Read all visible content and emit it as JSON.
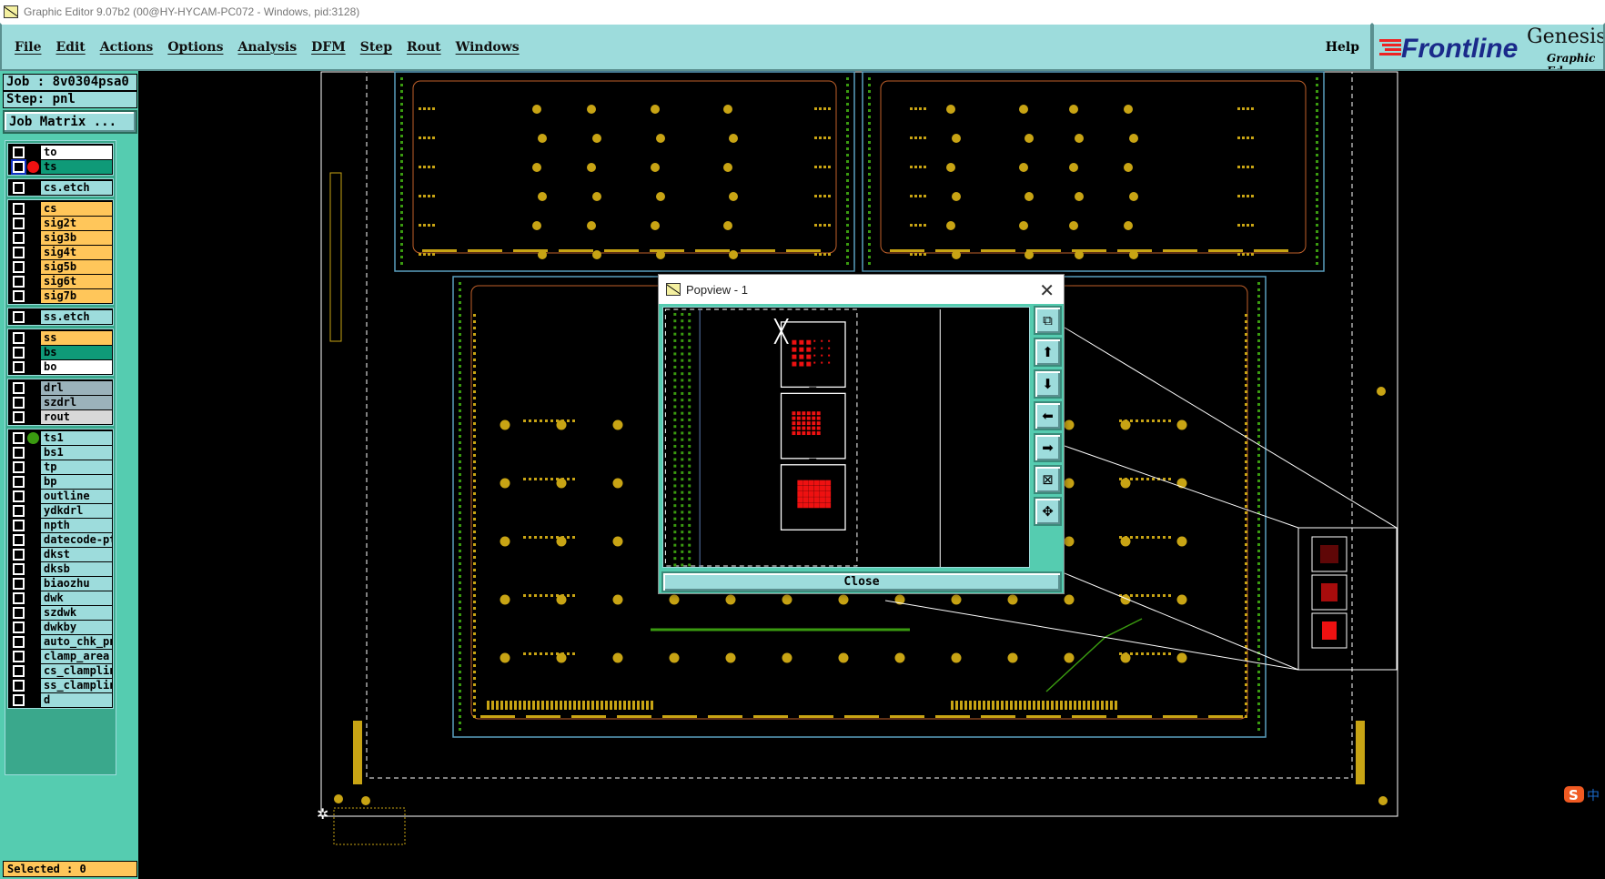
{
  "window": {
    "title": "Graphic Editor 9.07b2 (00@HY-HYCAM-PC072 - Windows, pid:3128)"
  },
  "menu": {
    "items": [
      "File",
      "Edit",
      "Actions",
      "Options",
      "Analysis",
      "DFM",
      "Step",
      "Rout",
      "Windows"
    ],
    "help": "Help"
  },
  "logo": {
    "brand": "Frontline",
    "product": "Genesis",
    "subtitle": "Graphic Ed"
  },
  "job": {
    "job": "Job : 8v0304psa0",
    "step": "Step: pnl",
    "matrix_button": "Job Matrix ..."
  },
  "layers": {
    "groups": [
      [
        {
          "name": "to",
          "color": "#ffffff"
        },
        {
          "name": "ts",
          "color": "#0f9a78",
          "dot": "#ee1111",
          "selected": true
        }
      ],
      [
        {
          "name": "cs.etch",
          "color": "#9ddcdc"
        }
      ],
      [
        {
          "name": "cs",
          "color": "#ffc65a"
        },
        {
          "name": "sig2t",
          "color": "#ffc65a"
        },
        {
          "name": "sig3b",
          "color": "#ffc65a"
        },
        {
          "name": "sig4t",
          "color": "#ffc65a"
        },
        {
          "name": "sig5b",
          "color": "#ffc65a"
        },
        {
          "name": "sig6t",
          "color": "#ffc65a"
        },
        {
          "name": "sig7b",
          "color": "#ffc65a"
        }
      ],
      [
        {
          "name": "ss.etch",
          "color": "#9ddcdc"
        }
      ],
      [
        {
          "name": "ss",
          "color": "#ffc65a"
        },
        {
          "name": "bs",
          "color": "#0f9a78"
        },
        {
          "name": "bo",
          "color": "#ffffff"
        }
      ],
      [
        {
          "name": "drl",
          "color": "#9bb2bb"
        },
        {
          "name": "szdrl",
          "color": "#9bb2bb"
        },
        {
          "name": "rout",
          "color": "#d8d8d8"
        }
      ],
      [
        {
          "name": "ts1",
          "color": "#9ddcdc",
          "dot": "#3a9a10"
        },
        {
          "name": "bs1",
          "color": "#9ddcdc"
        },
        {
          "name": "tp",
          "color": "#9ddcdc"
        },
        {
          "name": "bp",
          "color": "#9ddcdc"
        },
        {
          "name": "outline",
          "color": "#9ddcdc"
        },
        {
          "name": "ydkdrl",
          "color": "#9ddcdc"
        },
        {
          "name": "npth",
          "color": "#9ddcdc"
        },
        {
          "name": "datecode-pte",
          "color": "#9ddcdc"
        },
        {
          "name": "dkst",
          "color": "#9ddcdc"
        },
        {
          "name": "dksb",
          "color": "#9ddcdc"
        },
        {
          "name": "biaozhu",
          "color": "#9ddcdc"
        },
        {
          "name": "dwk",
          "color": "#9ddcdc"
        },
        {
          "name": "szdwk",
          "color": "#9ddcdc"
        },
        {
          "name": "dwkby",
          "color": "#9ddcdc"
        },
        {
          "name": "auto_chk_pnl",
          "color": "#9ddcdc"
        },
        {
          "name": "clamp_area",
          "color": "#9ddcdc"
        },
        {
          "name": "cs_clampline",
          "color": "#9ddcdc"
        },
        {
          "name": "ss_clampline",
          "color": "#9ddcdc"
        },
        {
          "name": "d",
          "color": "#9ddcdc"
        }
      ]
    ]
  },
  "status": {
    "selected": "Selected : 0"
  },
  "popview": {
    "title": "Popview - 1",
    "close_label": "Close",
    "tools": [
      "zoom-back-icon",
      "pan-up-icon",
      "pan-down-icon",
      "pan-left-icon",
      "pan-right-icon",
      "zoom-in-icon",
      "zoom-out-icon"
    ]
  },
  "colors": {
    "pad": "#c8a414",
    "trace": "#3a9a10",
    "outline": "#ffffff",
    "highlight": "#ee1111",
    "panel": "#55ccb0",
    "menu": "#9ddcdc"
  }
}
